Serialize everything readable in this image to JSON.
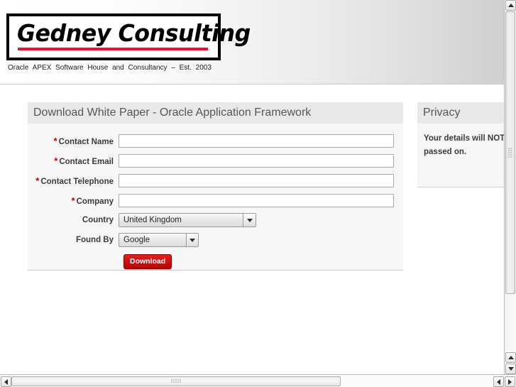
{
  "header": {
    "logo_text": "Gedney Consulting",
    "tagline": "Oracle  APEX  Software  House  and  Consultancy  –  Est.  2003"
  },
  "form": {
    "title": "Download White Paper - Oracle Application Framework",
    "required_marker": "*",
    "fields": [
      {
        "label": "Contact Name",
        "required": true,
        "type": "text",
        "value": "",
        "placeholder": ""
      },
      {
        "label": "Contact Email",
        "required": true,
        "type": "text",
        "value": "",
        "placeholder": ""
      },
      {
        "label": "Contact Telephone",
        "required": true,
        "type": "text",
        "value": "",
        "placeholder": ""
      },
      {
        "label": "Company",
        "required": true,
        "type": "text",
        "value": "",
        "placeholder": ""
      },
      {
        "label": "Country",
        "required": false,
        "type": "select",
        "value": "United Kingdom"
      },
      {
        "label": "Found By",
        "required": false,
        "type": "select",
        "value": "Google"
      }
    ],
    "submit_label": "Download"
  },
  "privacy": {
    "title": "Privacy",
    "line1": "Your details will NOT",
    "line2": "passed on."
  },
  "colors": {
    "brand_red": "#e8112d",
    "button_red": "#cf0d0d",
    "required_red": "#c00000",
    "panel_bg": "#f7f7f7",
    "panel_title_bg": "#e9e9e9",
    "title_text": "#565656"
  },
  "scrollbars": {
    "vertical": {
      "arrow_up": "▲",
      "arrow_down": "▼"
    },
    "horizontal": {
      "arrow_left": "◀",
      "arrow_right": "▶"
    }
  }
}
